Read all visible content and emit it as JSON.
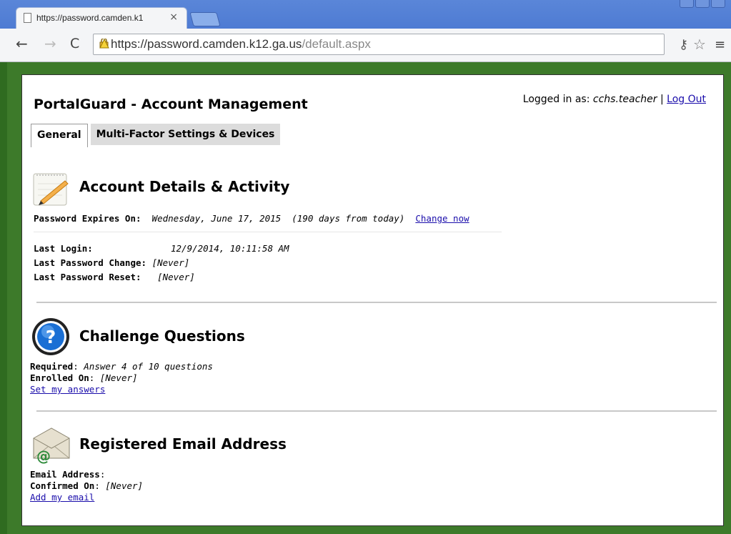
{
  "browser": {
    "tab_title": "https://password.camden.k1",
    "tab_close": "×",
    "url_host": "https://password.camden.k12.ga.us",
    "url_path": "/default.aspx"
  },
  "page": {
    "title": "PortalGuard - Account Management",
    "logged_in_label": "Logged in as:",
    "username": "cchs.teacher",
    "separator": "|",
    "logout": "Log Out",
    "tabs": [
      "General",
      "Multi-Factor Settings & Devices"
    ]
  },
  "account": {
    "title": "Account Details & Activity",
    "expires_label": "Password Expires On:",
    "expires_value": "Wednesday, June 17, 2015",
    "expires_days": "(190 days from today)",
    "change_now": "Change now",
    "last_login_label": "Last Login:",
    "last_login_value": "12/9/2014, 10:11:58 AM",
    "last_change_label": "Last Password Change:",
    "last_change_value": "[Never]",
    "last_reset_label": "Last Password Reset:",
    "last_reset_value": "[Never]"
  },
  "challenge": {
    "title": "Challenge Questions",
    "required_label": "Required",
    "required_value": "Answer 4 of 10 questions",
    "enrolled_label": "Enrolled On",
    "enrolled_value": "[Never]",
    "set_link": "Set my answers"
  },
  "email": {
    "title": "Registered Email Address",
    "address_label": "Email Address",
    "confirmed_label": "Confirmed On",
    "confirmed_value": "[Never]",
    "add_link": "Add my email"
  },
  "icons": {
    "question": "?",
    "at": "@"
  }
}
